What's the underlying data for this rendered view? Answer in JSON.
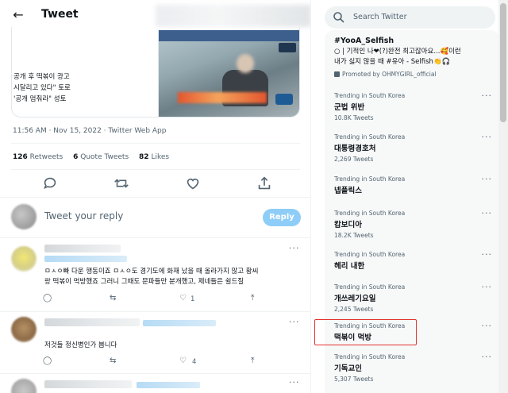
{
  "header": {
    "title": "Tweet"
  },
  "tweet": {
    "media_text_lines": [
      "공개 후 떡볶이 광고",
      "시달리고 있다\" 토로",
      "'공개 멈춰라\" 성토"
    ],
    "timestamp": "11:56 AM · Nov 15, 2022 · Twitter Web App",
    "stats": {
      "retweets_count": "126",
      "retweets_label": "Retweets",
      "quotes_count": "6",
      "quotes_label": "Quote Tweets",
      "likes_count": "82",
      "likes_label": "Likes"
    }
  },
  "reply": {
    "placeholder": "Tweet your reply",
    "button": "Reply"
  },
  "replies": [
    {
      "text_lines": [
        "ㅁㅅㅇ빠 다운 행동이죠 ㅁㅅㅇ도 경기도에 화재 났을 때 올라가지 않고 황씨",
        "랑 떡볶이 먹방했죠 그러니 그때도 문파들만 분개했고, 제네들은 쉴드질"
      ],
      "like_count": "1"
    },
    {
      "text_lines": [
        "저것들 정신병인가 봅니다"
      ],
      "like_count": "4"
    }
  ],
  "sidebar": {
    "search_placeholder": "Search Twitter",
    "promoted": {
      "hashtag": "#YooA_Selfish",
      "line1": "○ | 기적인 나❤(?)완전 최고잖아요...🥰이런",
      "line2": "내가 싫지 않을 때 #유아 - Selfish👏🎧",
      "promoted_by": "Promoted by OHMYGIRL_official"
    },
    "trends": [
      {
        "meta": "Trending in South Korea",
        "name": "군법 위반",
        "count": "10.8K Tweets"
      },
      {
        "meta": "Trending in South Korea",
        "name": "대통령경호처",
        "count": "2,269 Tweets"
      },
      {
        "meta": "Trending in South Korea",
        "name": "넵플릭스",
        "count": ""
      },
      {
        "meta": "Trending in South Korea",
        "name": "캄보디아",
        "count": "18.2K Tweets"
      },
      {
        "meta": "Trending in South Korea",
        "name": "헤리 내한",
        "count": ""
      },
      {
        "meta": "Trending in South Korea",
        "name": "개쓰레기요일",
        "count": "2,245 Tweets"
      },
      {
        "meta": "Trending in South Korea",
        "name": "떡볶이 먹방",
        "count": ""
      },
      {
        "meta": "Trending in South Korea",
        "name": "기독교인",
        "count": "5,307 Tweets"
      }
    ]
  },
  "colors": {
    "accent": "#1d9bf0",
    "reply_button": "#8ecdf8",
    "highlight": "#e3342f",
    "muted": "#536471"
  }
}
